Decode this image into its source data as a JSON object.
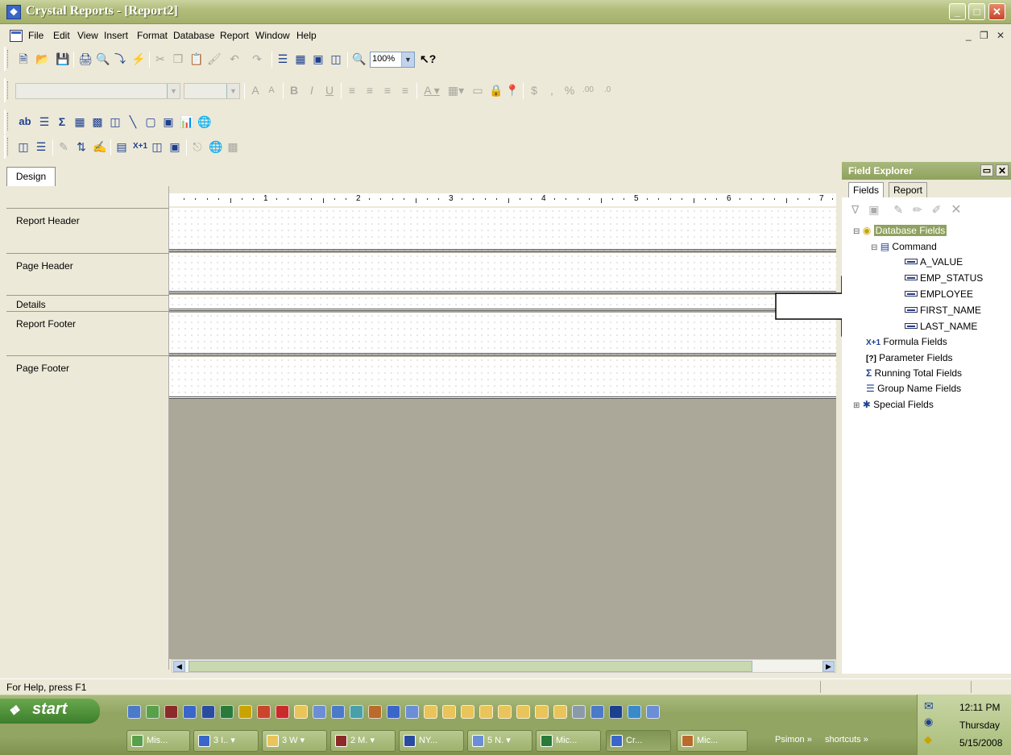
{
  "window": {
    "title": "Crystal Reports - [Report2]",
    "buttons": {
      "minimize": "_",
      "maximize": "□",
      "close": "✕"
    }
  },
  "menu": {
    "items": [
      "File",
      "Edit",
      "View",
      "Insert",
      "Format",
      "Database",
      "Report",
      "Window",
      "Help"
    ],
    "mdi_controls": [
      "_",
      "❐",
      "✕"
    ]
  },
  "toolbar1": {
    "zoom": "100%"
  },
  "design": {
    "tab_label": "Design",
    "ruler_marks": [
      "1",
      "2",
      "3",
      "4",
      "5",
      "6",
      "7"
    ],
    "nav_icons": [
      "✕",
      "|◄",
      "◄",
      "►",
      "►|",
      "■"
    ],
    "sections": [
      "Report Header",
      "Page Header",
      "Details",
      "Report Footer",
      "Page Footer"
    ]
  },
  "field_explorer": {
    "title": "Field Explorer",
    "tabs": [
      "Fields",
      "Report"
    ],
    "tree": {
      "database_fields": "Database Fields",
      "command": "Command",
      "fields": [
        "A_VALUE",
        "EMP_STATUS",
        "EMPLOYEE",
        "FIRST_NAME",
        "LAST_NAME"
      ],
      "others": [
        "Formula Fields",
        "Parameter Fields",
        "Running Total Fields",
        "Group Name Fields",
        "Special Fields"
      ],
      "icons": {
        "formula": "X+1",
        "parameter": "[?]",
        "running": "Σ",
        "group": "☰",
        "special": "✱"
      }
    }
  },
  "status_bar": {
    "text": "For Help, press F1"
  },
  "taskbar": {
    "start_label": "start",
    "buttons": [
      "Mis...",
      "3 I..",
      "3 W",
      "2 M.",
      "NY...",
      "5 N.",
      "Mic...",
      "Cr...",
      "Mic..."
    ],
    "toolbars": [
      "Psimon",
      "shortcuts"
    ],
    "chevron": "»",
    "time": "12:11 PM",
    "day": "Thursday",
    "date": "5/15/2008"
  },
  "colors": {
    "title_bar": "#a3b06a",
    "selected_tree_item": "#8fa15e",
    "design_background": "#aca899",
    "taskbar": "#93a563"
  }
}
